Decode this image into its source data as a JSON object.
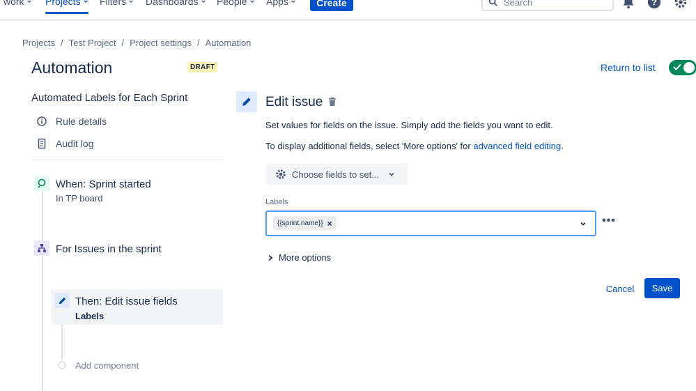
{
  "topnav": {
    "items": [
      {
        "label": "work",
        "active": false
      },
      {
        "label": "Projects",
        "active": true
      },
      {
        "label": "Filters",
        "active": false
      },
      {
        "label": "Dashboards",
        "active": false
      },
      {
        "label": "People",
        "active": false
      },
      {
        "label": "Apps",
        "active": false
      }
    ],
    "create_label": "Create",
    "search_placeholder": "Search",
    "icons": [
      "notifications-icon",
      "help-icon",
      "settings-icon"
    ]
  },
  "breadcrumb": [
    "Projects",
    "Test Project",
    "Project settings",
    "Automation"
  ],
  "page": {
    "title": "Automation",
    "badge": "DRAFT",
    "return_link": "Return to list",
    "enabled": true
  },
  "rule": {
    "name": "Automated Labels for Each Sprint",
    "links": [
      {
        "label": "Rule details",
        "icon": "info-icon"
      },
      {
        "label": "Audit log",
        "icon": "document-icon"
      }
    ],
    "steps": [
      {
        "title": "When: Sprint started",
        "subtitle": "In TP board",
        "icon": "trigger-icon"
      },
      {
        "title": "For Issues in the sprint",
        "subtitle": "",
        "icon": "branch-icon"
      },
      {
        "title": "Then: Edit issue fields",
        "subtitle": "Labels",
        "icon": "pencil-icon"
      }
    ],
    "add_component": "Add component"
  },
  "editor": {
    "title": "Edit issue",
    "desc1": "Set values for fields on the issue. Simply add the fields you want to edit.",
    "desc2_prefix": "To display additional fields, select 'More options' for ",
    "desc2_link": "advanced field editing",
    "desc2_suffix": ".",
    "choose_fields": "Choose fields to set...",
    "field_label": "Labels",
    "chip_value": "{{sprint.name}}",
    "chip_remove": "×",
    "more_options": "More options",
    "cancel": "Cancel",
    "save": "Save"
  },
  "colors": {
    "primary": "#0052cc",
    "toggle_on": "#00875a",
    "draft_bg": "#fff0b3",
    "focus_border": "#4c9aff"
  }
}
